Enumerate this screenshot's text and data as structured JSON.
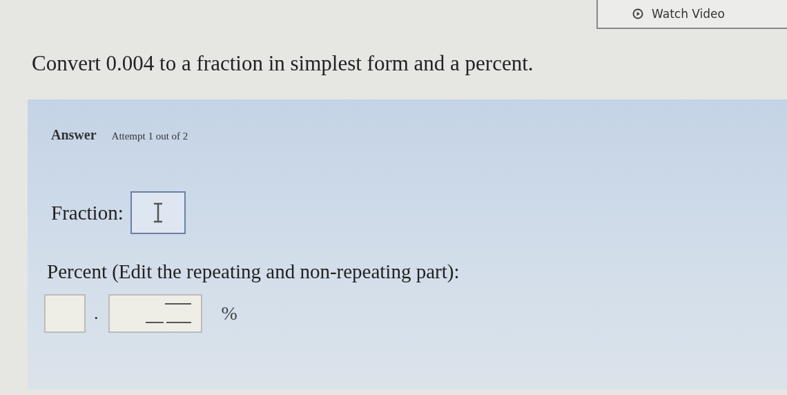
{
  "watch_video": {
    "label": "Watch Video"
  },
  "question": "Convert 0.004 to a fraction in simplest form and a percent.",
  "answer": {
    "heading": "Answer",
    "attempt": "Attempt 1 out of 2"
  },
  "fraction": {
    "label": "Fraction:"
  },
  "percent": {
    "label": "Percent (Edit the repeating and non-repeating part):",
    "decimal_point": ".",
    "unit": "%"
  }
}
